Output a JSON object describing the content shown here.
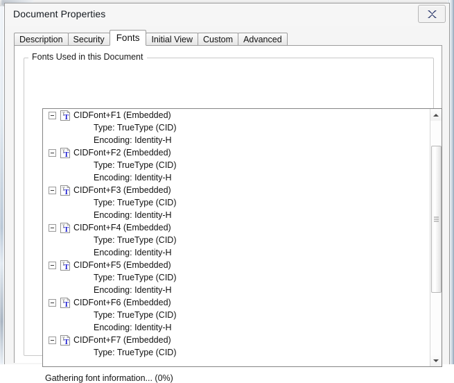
{
  "window": {
    "title": "Document Properties",
    "close_label": "Close",
    "close_icon": "close-x-icon"
  },
  "tabs": [
    {
      "label": "Description",
      "active": false
    },
    {
      "label": "Security",
      "active": false
    },
    {
      "label": "Fonts",
      "active": true
    },
    {
      "label": "Initial View",
      "active": false
    },
    {
      "label": "Custom",
      "active": false
    },
    {
      "label": "Advanced",
      "active": false
    }
  ],
  "fonts_panel": {
    "groupbox_label": "Fonts Used in this Document",
    "status": "Gathering font information... (0%)",
    "fonts": [
      {
        "name": "CIDFont+F1 (Embedded)",
        "icon": "truetype-font-icon",
        "expanded": true,
        "details": [
          "Type: TrueType (CID)",
          "Encoding: Identity-H"
        ]
      },
      {
        "name": "CIDFont+F2 (Embedded)",
        "icon": "truetype-font-icon",
        "expanded": true,
        "details": [
          "Type: TrueType (CID)",
          "Encoding: Identity-H"
        ]
      },
      {
        "name": "CIDFont+F3 (Embedded)",
        "icon": "truetype-font-icon",
        "expanded": true,
        "details": [
          "Type: TrueType (CID)",
          "Encoding: Identity-H"
        ]
      },
      {
        "name": "CIDFont+F4 (Embedded)",
        "icon": "truetype-font-icon",
        "expanded": true,
        "details": [
          "Type: TrueType (CID)",
          "Encoding: Identity-H"
        ]
      },
      {
        "name": "CIDFont+F5 (Embedded)",
        "icon": "truetype-font-icon",
        "expanded": true,
        "details": [
          "Type: TrueType (CID)",
          "Encoding: Identity-H"
        ]
      },
      {
        "name": "CIDFont+F6 (Embedded)",
        "icon": "truetype-font-icon",
        "expanded": true,
        "details": [
          "Type: TrueType (CID)",
          "Encoding: Identity-H"
        ]
      },
      {
        "name": "CIDFont+F7 (Embedded)",
        "icon": "truetype-font-icon",
        "expanded": true,
        "details": [
          "Type: TrueType (CID)"
        ]
      }
    ],
    "scrollbar": {
      "up_icon": "scroll-up-arrow-icon",
      "down_icon": "scroll-down-arrow-icon",
      "thumb_top_pct": 14,
      "thumb_height_pct": 57
    }
  },
  "colors": {
    "dialog_background": "#f5f5f5",
    "page_background": "#ffffff",
    "border": "#9c9c9c",
    "text": "#111111",
    "font_icon_blue": "#1a1ad0"
  }
}
